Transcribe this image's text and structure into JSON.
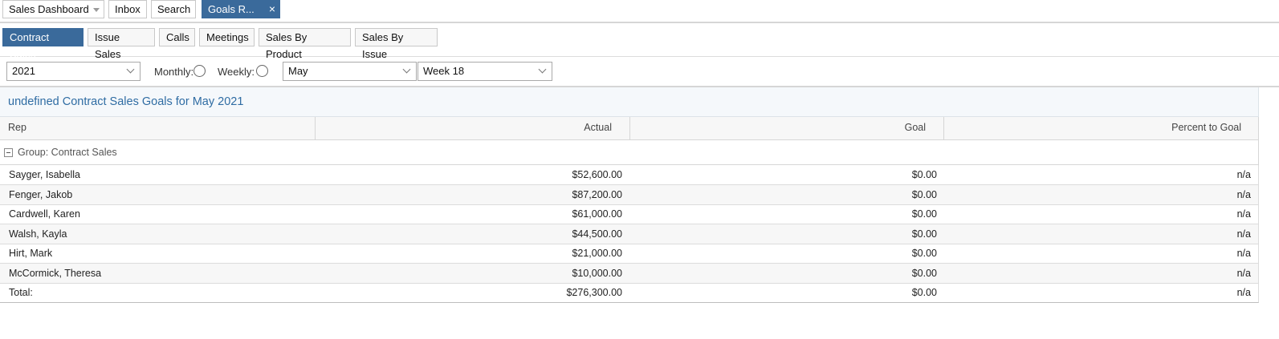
{
  "top_tabs": {
    "dashboard": "Sales Dashboard",
    "inbox": "Inbox",
    "search": "Search",
    "goals": "Goals R...",
    "close": "×"
  },
  "sub_tabs": [
    "Contract Sales",
    "Issue Sales",
    "Calls",
    "Meetings",
    "Sales By Product",
    "Sales By Issue"
  ],
  "filters": {
    "year": "2021",
    "monthly_label": "Monthly:",
    "weekly_label": "Weekly:",
    "month": "May",
    "week": "Week 18"
  },
  "grid": {
    "title": "undefined Contract Sales Goals for May 2021",
    "columns": [
      "Rep",
      "Actual",
      "Goal",
      "Percent to Goal"
    ],
    "group_label": "Group: Contract Sales",
    "rows": [
      {
        "rep": "Sayger, Isabella",
        "actual": "$52,600.00",
        "goal": "$0.00",
        "pct": "n/a"
      },
      {
        "rep": "Fenger, Jakob",
        "actual": "$87,200.00",
        "goal": "$0.00",
        "pct": "n/a"
      },
      {
        "rep": "Cardwell, Karen",
        "actual": "$61,000.00",
        "goal": "$0.00",
        "pct": "n/a"
      },
      {
        "rep": "Walsh, Kayla",
        "actual": "$44,500.00",
        "goal": "$0.00",
        "pct": "n/a"
      },
      {
        "rep": "Hirt, Mark",
        "actual": "$21,000.00",
        "goal": "$0.00",
        "pct": "n/a"
      },
      {
        "rep": "McCormick, Theresa",
        "actual": "$10,000.00",
        "goal": "$0.00",
        "pct": "n/a"
      }
    ],
    "total": {
      "rep": "Total:",
      "actual": "$276,300.00",
      "goal": "$0.00",
      "pct": "n/a"
    }
  },
  "colors": {
    "accent": "#3a6a9b",
    "title_text": "#2f6ca3"
  }
}
